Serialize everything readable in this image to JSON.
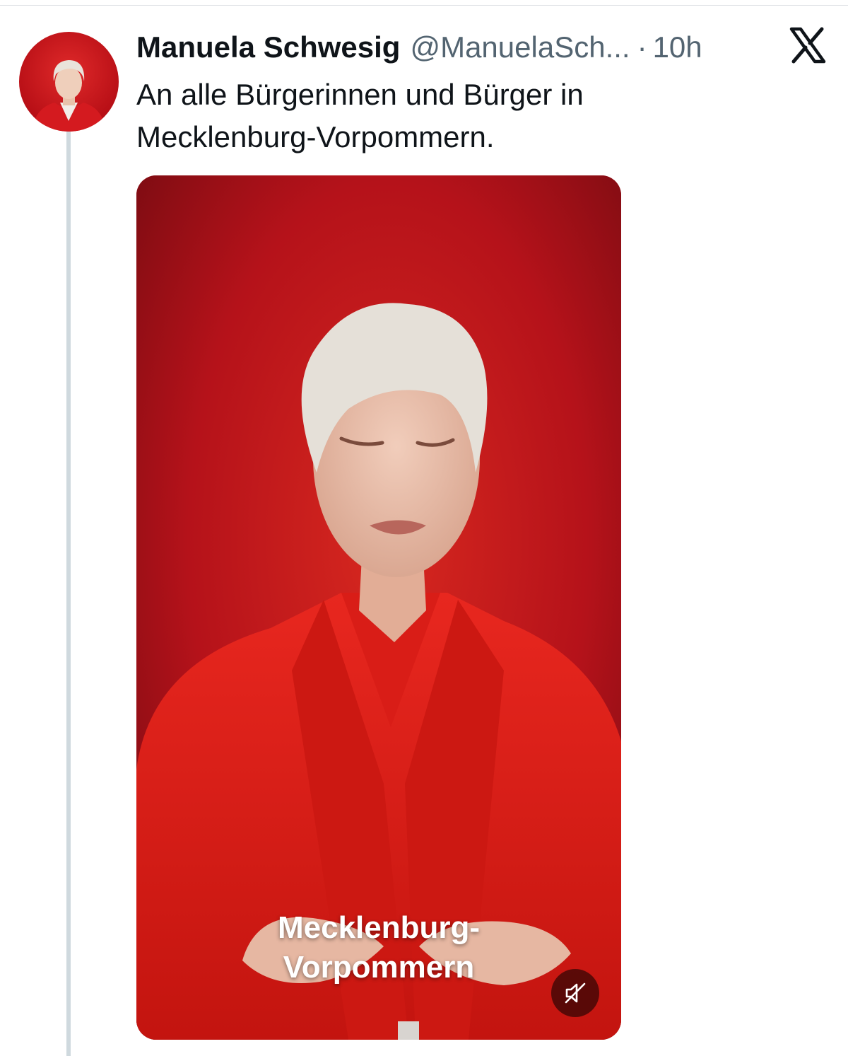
{
  "tweet": {
    "display_name": "Manuela Schwesig",
    "handle": "@ManuelaSch...",
    "separator": "·",
    "timestamp": "10h",
    "text_lines": [
      "An alle Bürgerinnen und Bürger in",
      "Mecklenburg-Vorpommern."
    ]
  },
  "video": {
    "caption_lines": [
      "Mecklenburg-",
      "Vorpommern"
    ],
    "mute_icon": "speaker-muted-icon"
  },
  "icons": {
    "platform_logo": "x-logo-icon"
  },
  "colors": {
    "video_background": "#b5121a",
    "jacket": "#e3201c",
    "handle_gray": "#536471",
    "thread_line": "#cfd9de"
  }
}
